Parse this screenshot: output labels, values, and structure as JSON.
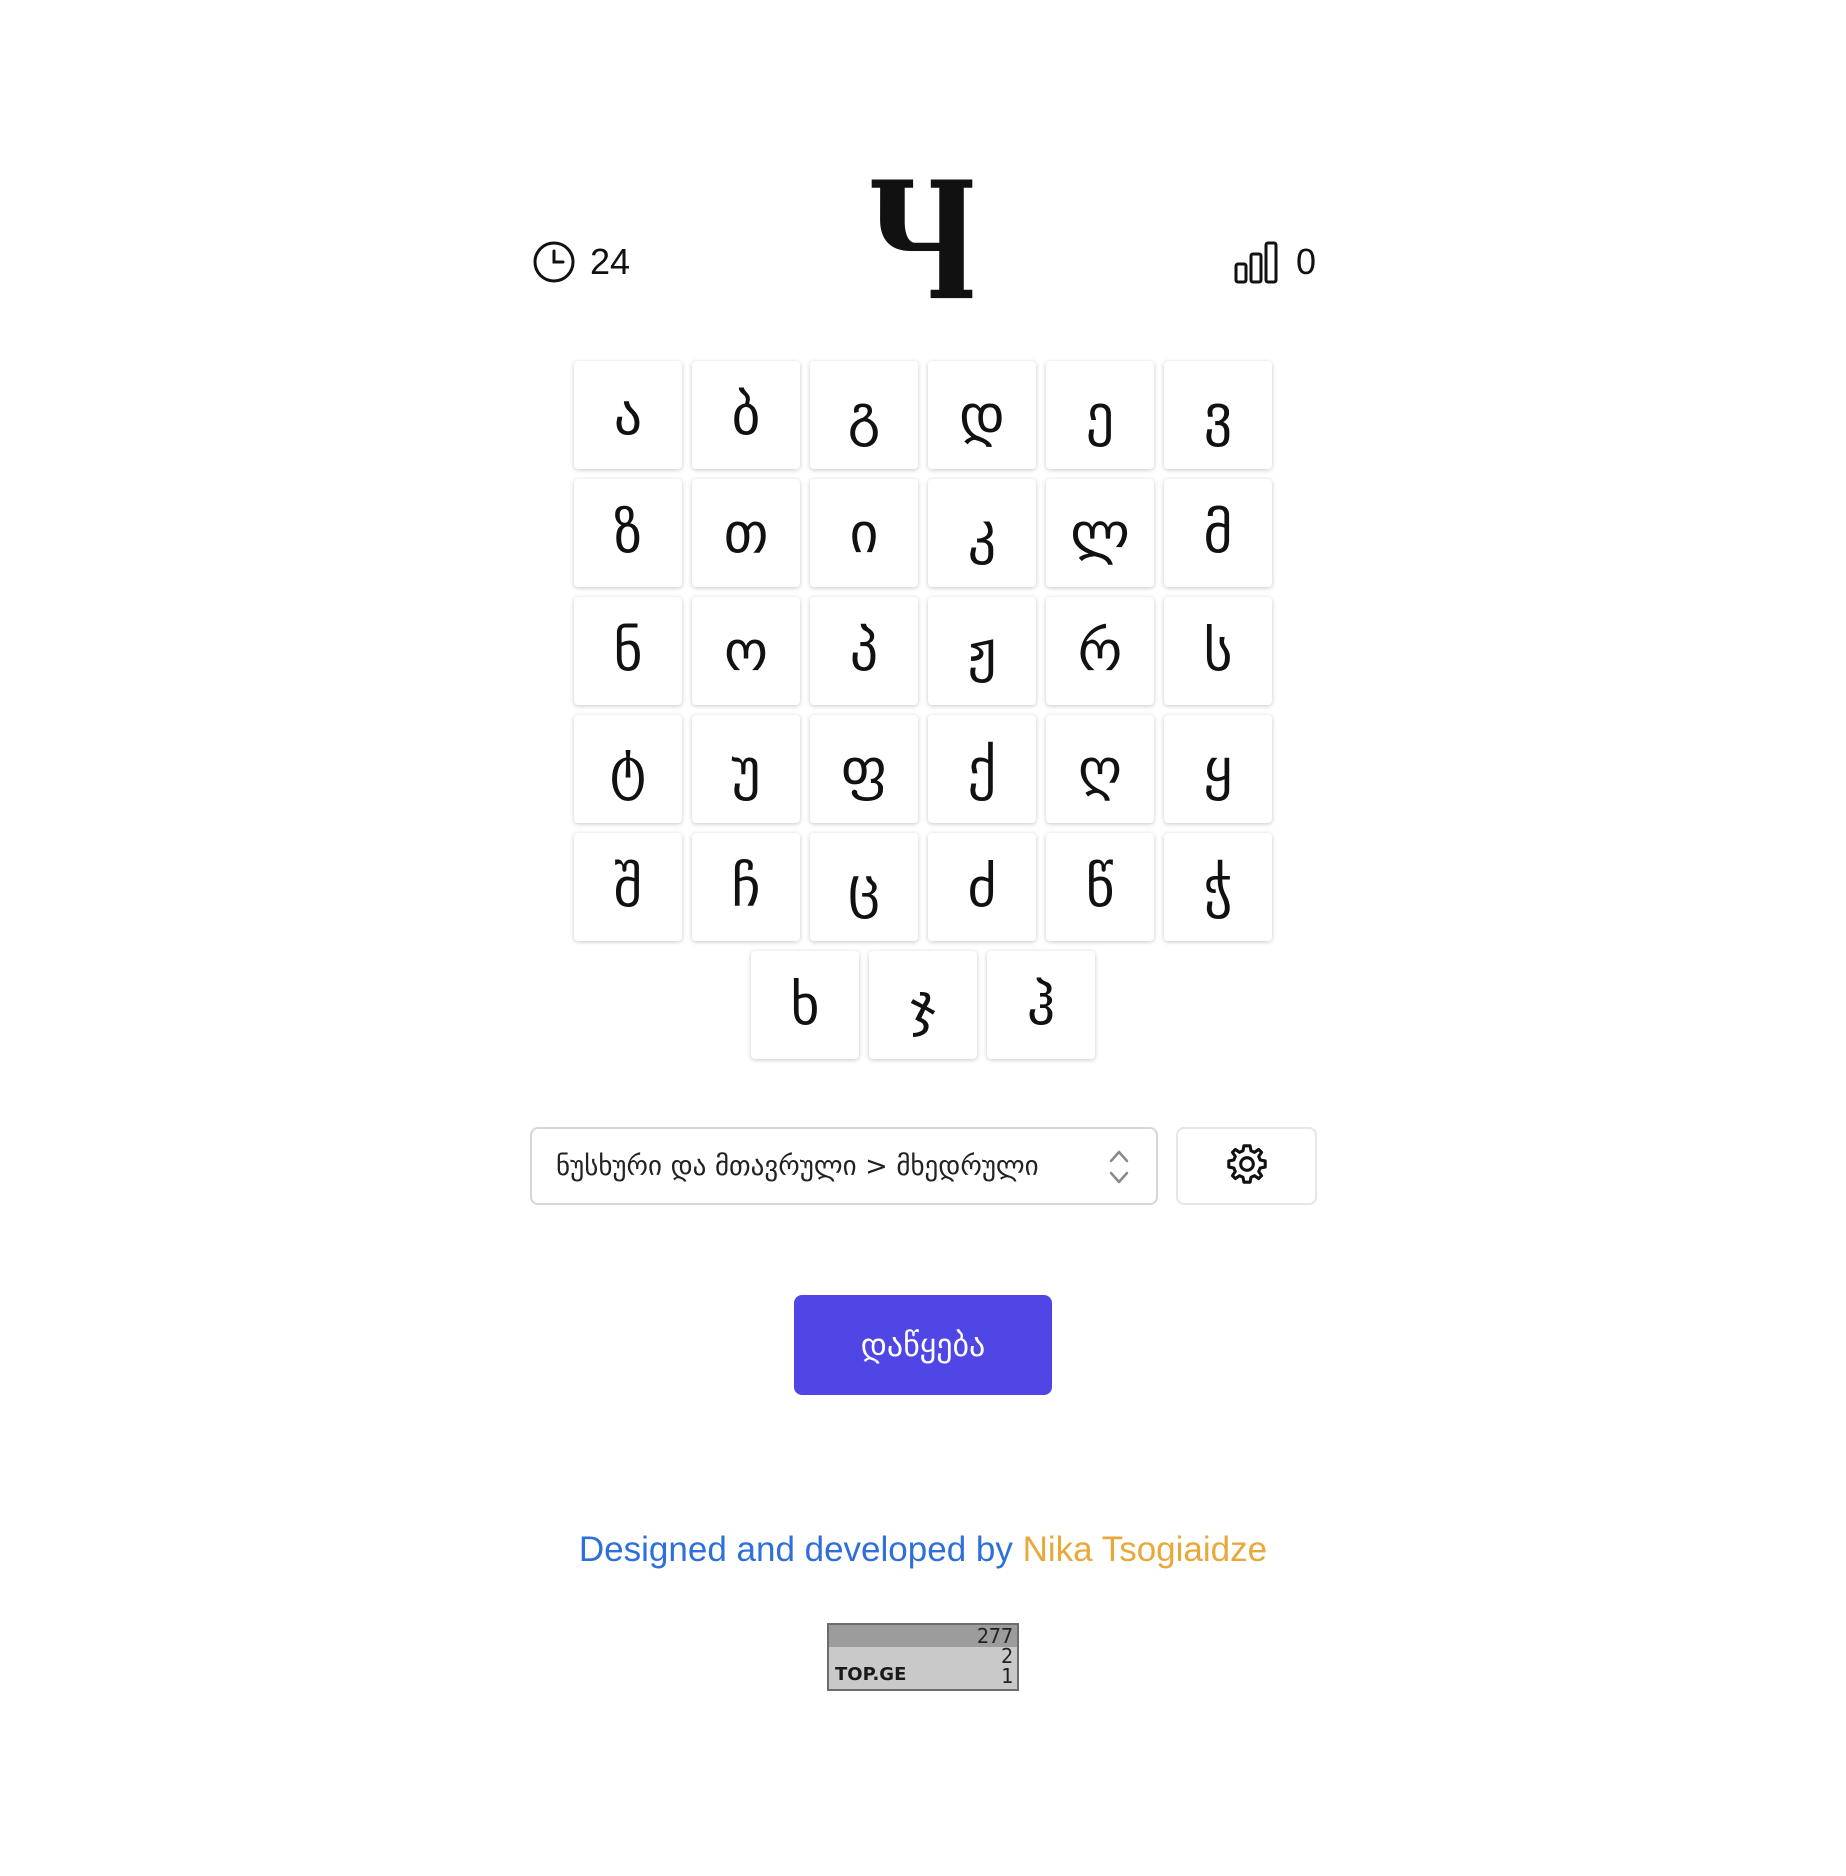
{
  "header": {
    "timer_value": "24",
    "target_letter": "Ⴗ",
    "score_value": "0"
  },
  "keyboard": {
    "rows": [
      [
        "ა",
        "ბ",
        "გ",
        "დ",
        "ე",
        "ვ"
      ],
      [
        "ზ",
        "თ",
        "ი",
        "კ",
        "ლ",
        "მ"
      ],
      [
        "ნ",
        "ო",
        "პ",
        "ჟ",
        "რ",
        "ს"
      ],
      [
        "ტ",
        "უ",
        "ფ",
        "ქ",
        "ღ",
        "ყ"
      ],
      [
        "შ",
        "ჩ",
        "ც",
        "ძ",
        "წ",
        "ჭ"
      ],
      [
        "ხ",
        "ჯ",
        "ჰ"
      ]
    ]
  },
  "controls": {
    "mode_select": "ნუსხური და მთავრული > მხედრული",
    "settings_icon": "gear-icon"
  },
  "start_button": {
    "label": "დაწყება",
    "color": "#4f46e5"
  },
  "footer": {
    "credit_lead": "Designed and developed by",
    "credit_author": "Nika Tsogiaidze",
    "lead_color": "#2f6fdc",
    "author_color": "#e8a93a"
  },
  "counter_badge": {
    "brand": "TOP.GE",
    "values": [
      "277",
      "2",
      "1"
    ]
  }
}
